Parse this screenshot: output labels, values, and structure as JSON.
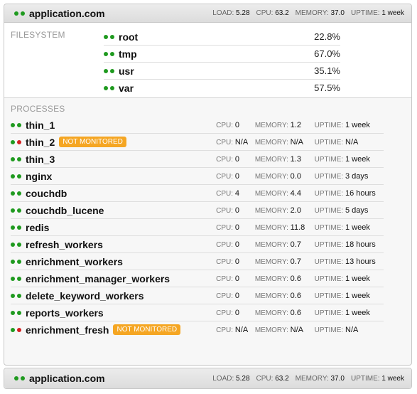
{
  "hosts": [
    {
      "name": "application.com",
      "stats": {
        "load_label": "LOAD:",
        "load": "5.28",
        "cpu_label": "CPU:",
        "cpu": "63.2",
        "memory_label": "MEMORY:",
        "memory": "37.0",
        "uptime_label": "UPTIME:",
        "uptime": "1 week"
      },
      "filesystem": {
        "label": "FILESYSTEM",
        "items": [
          {
            "name": "root",
            "usage": "22.8%"
          },
          {
            "name": "tmp",
            "usage": "67.0%"
          },
          {
            "name": "usr",
            "usage": "35.1%"
          },
          {
            "name": "var",
            "usage": "57.5%"
          }
        ]
      },
      "processes": {
        "label": "PROCESSES",
        "cpu_label": "CPU:",
        "memory_label": "MEMORY:",
        "uptime_label": "UPTIME:",
        "items": [
          {
            "name": "thin_1",
            "status": "ok",
            "badge": "",
            "cpu": "0",
            "memory": "1.2",
            "uptime": "1 week"
          },
          {
            "name": "thin_2",
            "status": "warn",
            "badge": "NOT MONITORED",
            "cpu": "N/A",
            "memory": "N/A",
            "uptime": "N/A"
          },
          {
            "name": "thin_3",
            "status": "ok",
            "badge": "",
            "cpu": "0",
            "memory": "1.3",
            "uptime": "1 week"
          },
          {
            "name": "nginx",
            "status": "ok",
            "badge": "",
            "cpu": "0",
            "memory": "0.0",
            "uptime": "3 days"
          },
          {
            "name": "couchdb",
            "status": "ok",
            "badge": "",
            "cpu": "4",
            "memory": "4.4",
            "uptime": "16 hours"
          },
          {
            "name": "couchdb_lucene",
            "status": "ok",
            "badge": "",
            "cpu": "0",
            "memory": "2.0",
            "uptime": "5 days"
          },
          {
            "name": "redis",
            "status": "ok",
            "badge": "",
            "cpu": "0",
            "memory": "11.8",
            "uptime": "1 week"
          },
          {
            "name": "refresh_workers",
            "status": "ok",
            "badge": "",
            "cpu": "0",
            "memory": "0.7",
            "uptime": "18 hours"
          },
          {
            "name": "enrichment_workers",
            "status": "ok",
            "badge": "",
            "cpu": "0",
            "memory": "0.7",
            "uptime": "13 hours"
          },
          {
            "name": "enrichment_manager_workers",
            "status": "ok",
            "badge": "",
            "cpu": "0",
            "memory": "0.6",
            "uptime": "1 week"
          },
          {
            "name": "delete_keyword_workers",
            "status": "ok",
            "badge": "",
            "cpu": "0",
            "memory": "0.6",
            "uptime": "1 week"
          },
          {
            "name": "reports_workers",
            "status": "ok",
            "badge": "",
            "cpu": "0",
            "memory": "0.6",
            "uptime": "1 week"
          },
          {
            "name": "enrichment_fresh",
            "status": "warn",
            "badge": "NOT MONITORED",
            "cpu": "N/A",
            "memory": "N/A",
            "uptime": "N/A"
          }
        ]
      }
    },
    {
      "name": "application.com",
      "stats": {
        "load_label": "LOAD:",
        "load": "5.28",
        "cpu_label": "CPU:",
        "cpu": "63.2",
        "memory_label": "MEMORY:",
        "memory": "37.0",
        "uptime_label": "UPTIME:",
        "uptime": "1 week"
      }
    }
  ],
  "colors": {
    "status_ok": "#1f9a1f",
    "status_warn": "#d42020",
    "badge": "#f5a623"
  },
  "icons": {
    "status": "status-dots-icon"
  }
}
